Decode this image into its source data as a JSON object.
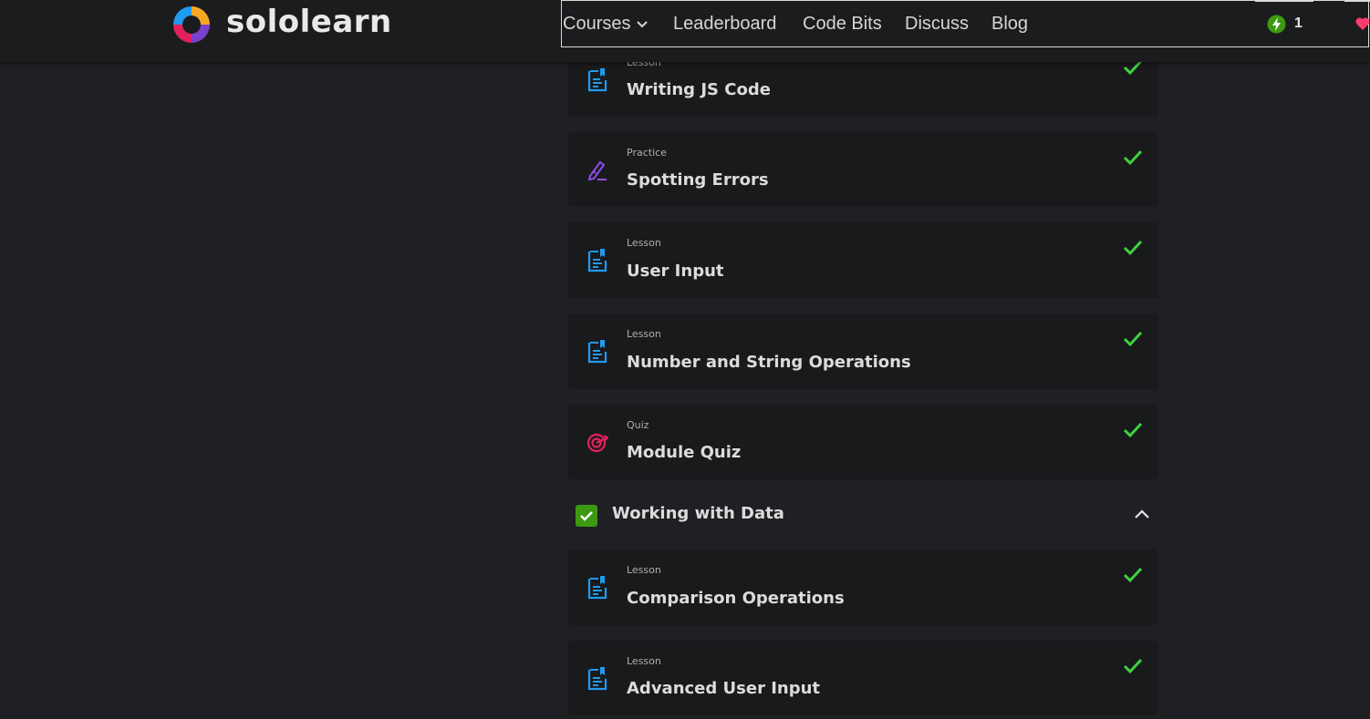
{
  "brand": {
    "name": "sololearn"
  },
  "nav": {
    "items": [
      "Courses",
      "Leaderboard",
      "Code Bits",
      "Discuss",
      "Blog"
    ],
    "streak_count": "1"
  },
  "colors": {
    "lesson_icon": "#1f9bf0",
    "practice_icon": "#8e4ee8",
    "quiz_icon": "#e3225c",
    "check": "#3fd13f",
    "module_check_bg": "#3c9a12",
    "bolt_bg": "#3c9a12",
    "heart": "#ff3c6e"
  },
  "lessons_top": [
    {
      "type": "Lesson",
      "title": "Writing JS Code",
      "icon": "lesson-icon",
      "completed": true
    },
    {
      "type": "Practice",
      "title": "Spotting Errors",
      "icon": "practice-icon",
      "completed": true
    },
    {
      "type": "Lesson",
      "title": "User Input",
      "icon": "lesson-icon",
      "completed": true
    },
    {
      "type": "Lesson",
      "title": "Number and String Operations",
      "icon": "lesson-icon",
      "completed": true
    },
    {
      "type": "Quiz",
      "title": "Module Quiz",
      "icon": "quiz-icon",
      "completed": true
    }
  ],
  "module": {
    "title": "Working with Data",
    "completed": true,
    "expanded": true
  },
  "lessons_bottom": [
    {
      "type": "Lesson",
      "title": "Comparison Operations",
      "icon": "lesson-icon",
      "completed": true
    },
    {
      "type": "Lesson",
      "title": "Advanced User Input",
      "icon": "lesson-icon",
      "completed": true
    }
  ]
}
